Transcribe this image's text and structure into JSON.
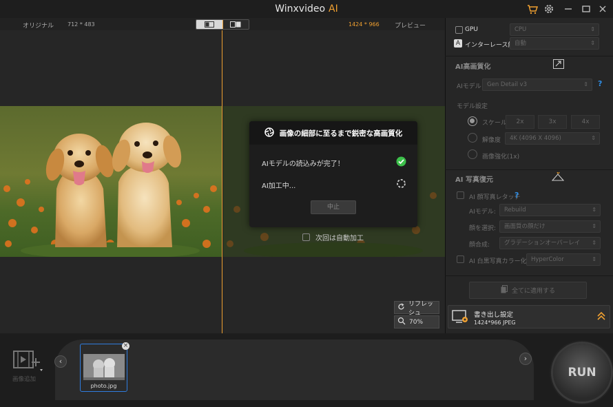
{
  "titlebar": {
    "app_name": "Winxvideo",
    "app_ai": "AI",
    "icons": [
      "cart-icon",
      "gear-icon",
      "minimize-icon",
      "maximize-icon",
      "close-icon"
    ]
  },
  "preview": {
    "original_label": "オリジナル",
    "original_size": "712 * 483",
    "output_size": "1424 * 966",
    "preview_label": "プレビュー",
    "refresh_label": "リフレッシュ",
    "zoom_label": "70%"
  },
  "dialog": {
    "title": "画像の細部に至るまで鋭密な高画質化",
    "row1": "AIモデルの読込みが完了！",
    "row2": "AI加工中...",
    "stop_label": "中止",
    "auto_label": "次回は自動加工"
  },
  "panel": {
    "gpu_label": "GPU",
    "gpu_value": "CPU",
    "deinterlace_label": "インターレース解除",
    "deinterlace_value": "自動",
    "upscale_title": "AI高画質化",
    "model_label": "AIモデル",
    "model_value": "Gen Detail v3",
    "model_settings_label": "モデル設定",
    "scale_label": "スケール",
    "scale_options": [
      "2x",
      "3x",
      "4x"
    ],
    "resolution_label": "解像度",
    "resolution_value": "4K (4096 X 4096)",
    "enhance_label": "画像強化(1x)",
    "restore_title": "AI 写真復元",
    "face_label": "AI 顔写真レタッチ",
    "face_model_label": "AIモデル:",
    "face_model_value": "Rebuild",
    "face_select_label": "顔を選択:",
    "face_select_value": "画面質の顔だけ",
    "blend_label": "顔合成:",
    "blend_value": "グラデーションオーバーレイ",
    "colorize_label": "AI 白黒写真カラー化:",
    "colorize_value": "HyperColor",
    "apply_all_label": "全てに適用する",
    "export_title": "書き出し設定",
    "export_info": "1424*966  JPEG"
  },
  "bottom": {
    "add_image_label": "画像追加",
    "thumb_name": "photo.jpg",
    "run_label": "RUN"
  },
  "colors": {
    "accent": "#f0a030",
    "blue": "#2f7de0",
    "check_green": "#3cc04a"
  }
}
